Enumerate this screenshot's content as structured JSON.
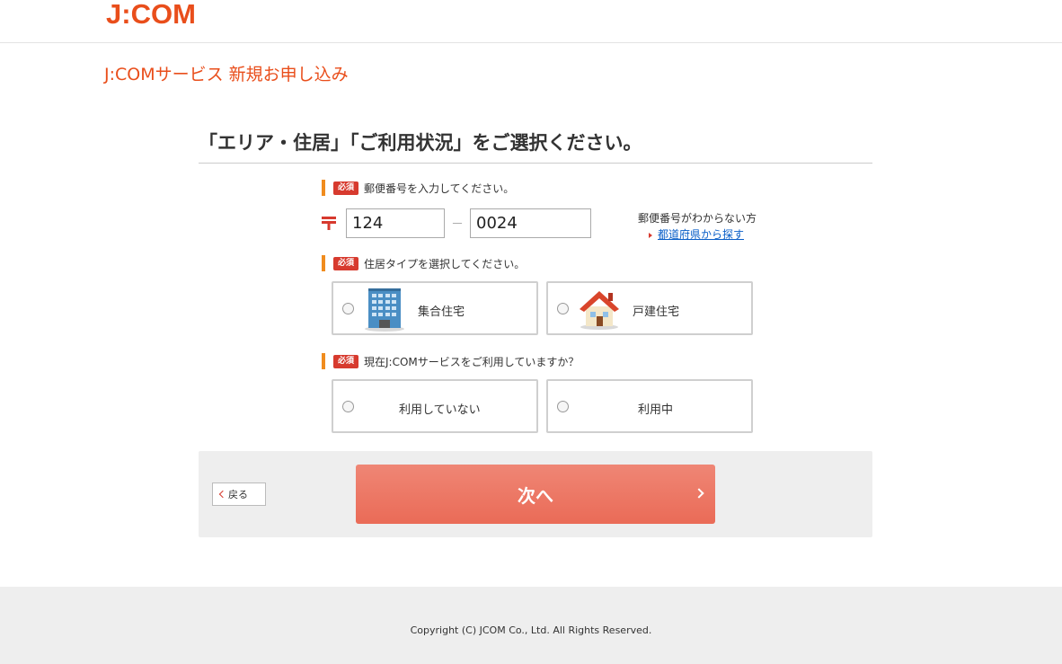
{
  "header": {
    "logo": "J:COM"
  },
  "service_title": "J:COMサービス 新規お申し込み",
  "main_heading": "「エリア・住居」「ご利用状況」をご選択ください。",
  "required_badge": "必須",
  "postal": {
    "label": "郵便番号を入力してください。",
    "zip1": "124",
    "zip2": "0024",
    "dash": "－",
    "help_label": "郵便番号がわからない方",
    "help_link": "都道府県から探す"
  },
  "residence": {
    "label": "住居タイプを選択してください。",
    "options": [
      {
        "label": "集合住宅",
        "icon": "apartment-building-icon"
      },
      {
        "label": "戸建住宅",
        "icon": "house-icon"
      }
    ]
  },
  "usage": {
    "label": "現在J:COMサービスをご利用していますか？",
    "options": [
      {
        "label": "利用していない"
      },
      {
        "label": "利用中"
      }
    ]
  },
  "nav": {
    "back_label": "戻る",
    "next_label": "次へ"
  },
  "footer": {
    "copyright": "Copyright (C) JCOM Co., Ltd. All Rights Reserved."
  },
  "colors": {
    "brand": "#e94e1b",
    "accent_bar": "#f08c1e",
    "badge": "#d73a2e",
    "next_button": "#ea6b57",
    "link": "#0a5fc8"
  }
}
